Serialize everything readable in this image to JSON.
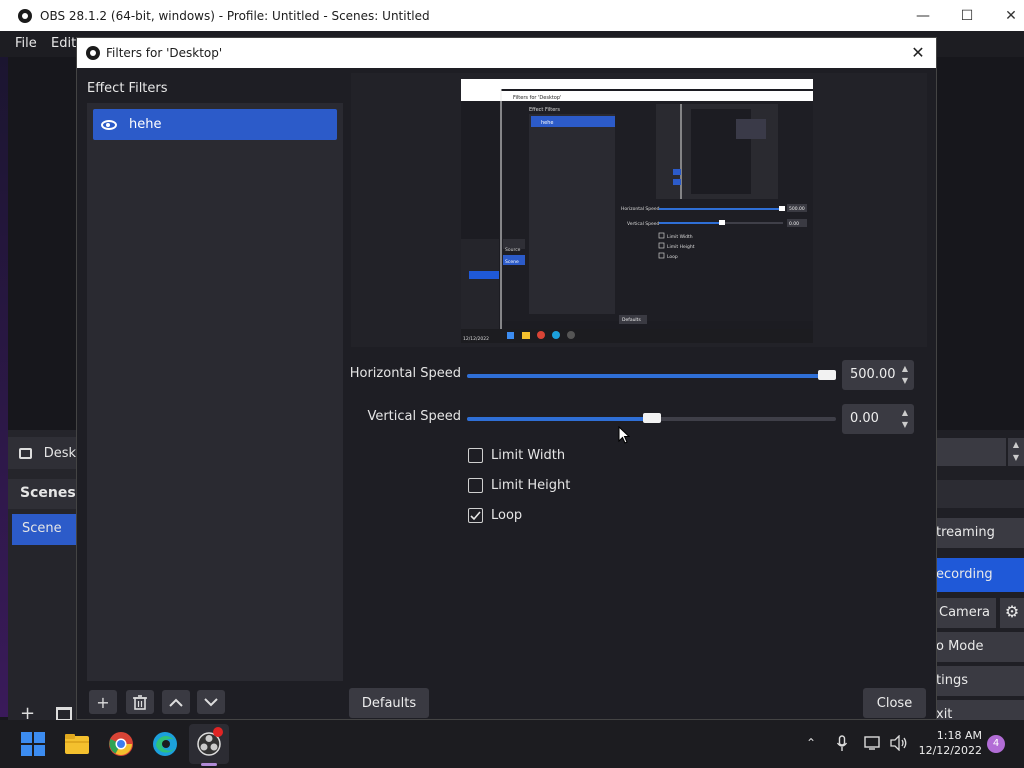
{
  "obs": {
    "title": "OBS 28.1.2 (64-bit, windows) - Profile: Untitled - Scenes: Untitled",
    "menu": [
      "File",
      "Edit"
    ],
    "sources": {
      "item": "Desk"
    },
    "scenes": {
      "header": "Scenes",
      "item": "Scene"
    },
    "controls": [
      "treaming",
      "ecording",
      "Camera",
      "o Mode",
      "tings",
      "xit"
    ]
  },
  "dialog": {
    "title": "Filters for 'Desktop'",
    "effect_filters_label": "Effect Filters",
    "filters": [
      {
        "name": "hehe",
        "visible": true
      }
    ],
    "properties": {
      "horizontal_speed": {
        "label": "Horizontal Speed",
        "value": "500.00",
        "fraction": 0.98
      },
      "vertical_speed": {
        "label": "Vertical Speed",
        "value": "0.00",
        "fraction": 0.5
      }
    },
    "checkboxes": [
      {
        "label": "Limit Width",
        "checked": false
      },
      {
        "label": "Limit Height",
        "checked": false
      },
      {
        "label": "Loop",
        "checked": true
      }
    ],
    "defaults_button": "Defaults",
    "close_button": "Close"
  },
  "preview_thumb": {
    "dialog_title": "Filters for 'Desktop'",
    "effect_filters": "Effect Filters",
    "filter": "hehe",
    "horizontal_speed": "Horizontal Speed",
    "vertical_speed": "Vertical Speed",
    "h_value": "500.00",
    "v_value": "0.00",
    "limit_width": "Limit Width",
    "limit_height": "Limit Height",
    "loop": "Loop",
    "defaults": "Defaults",
    "source": "Source",
    "scene": "Scene",
    "date": "12/12/2022"
  },
  "taskbar": {
    "time": "1:18 AM",
    "date": "12/12/2022",
    "notifications": "4",
    "colors": {
      "accent": "#2c5bc9",
      "slider": "#2f6fd6",
      "record": "#1f59d8"
    }
  }
}
